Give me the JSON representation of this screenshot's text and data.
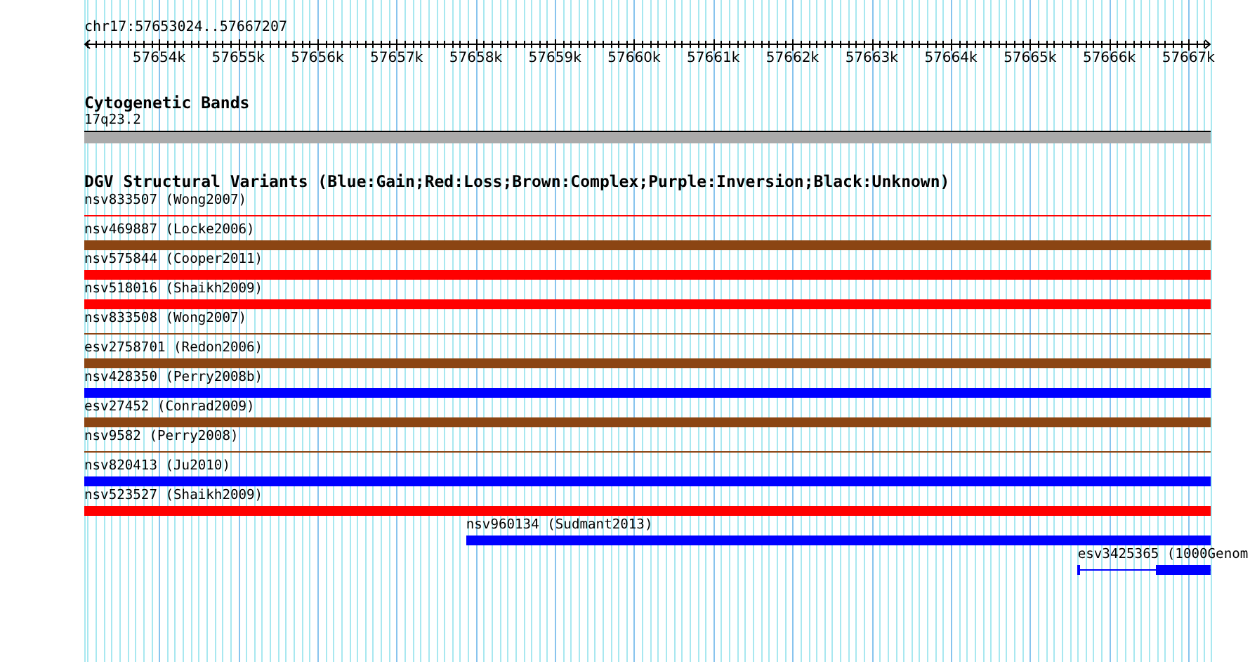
{
  "region": "chr17:57653024..57667207",
  "ruler": {
    "ticks": [
      "57654k",
      "57655k",
      "57656k",
      "57657k",
      "57658k",
      "57659k",
      "57660k",
      "57661k",
      "57662k",
      "57663k",
      "57664k",
      "57665k",
      "57666k",
      "57667k"
    ]
  },
  "tracks": [
    {
      "title": "Cytogenetic Bands",
      "kind": "bands",
      "features": [
        {
          "label": "17q23.2",
          "color": "#aaaaaa",
          "kind": "band",
          "level": 1
        }
      ]
    },
    {
      "title": "DGV Structural Variants (Blue:Gain;Red:Loss;Brown:Complex;Purple:Inversion;Black:Unknown)",
      "kind": "variants",
      "features": [
        {
          "label": "nsv833507 (Wong2007)",
          "color": "#ff0000",
          "kind": "thin",
          "level": 1
        },
        {
          "label": "nsv469887 (Locke2006)",
          "color": "#8b4513",
          "kind": "thick",
          "level": 1
        },
        {
          "label": "nsv575844 (Cooper2011)",
          "color": "#ff0000",
          "kind": "thick",
          "level": 1
        },
        {
          "label": "nsv518016 (Shaikh2009)",
          "color": "#ff0000",
          "kind": "thick",
          "level": 1
        },
        {
          "label": "nsv833508 (Wong2007)",
          "color": "#8b4513",
          "kind": "thin",
          "level": 1
        },
        {
          "label": "esv2758701 (Redon2006)",
          "color": "#8b4513",
          "kind": "thick",
          "level": 1
        },
        {
          "label": "nsv428350 (Perry2008b)",
          "color": "#0000ff",
          "kind": "thick",
          "level": 1
        },
        {
          "label": "esv27452 (Conrad2009)",
          "color": "#8b4513",
          "kind": "thick",
          "level": 1
        },
        {
          "label": "nsv9582 (Perry2008)",
          "color": "#8b4513",
          "kind": "thin",
          "level": 1
        },
        {
          "label": "nsv820413 (Ju2010)",
          "color": "#0000ff",
          "kind": "thick",
          "level": 1
        },
        {
          "label": "nsv523527 (Shaikh2009)",
          "color": "#ff0000",
          "kind": "thick",
          "level": 1
        },
        {
          "label": "nsv960134 (Sudmant2013)",
          "color": "#0000ff",
          "kind": "thick",
          "level": 0.661
        },
        {
          "label": "esv3425365 (1000Genom",
          "color": "#0000ff",
          "kind": "split",
          "level": 0.118
        }
      ]
    }
  ]
}
